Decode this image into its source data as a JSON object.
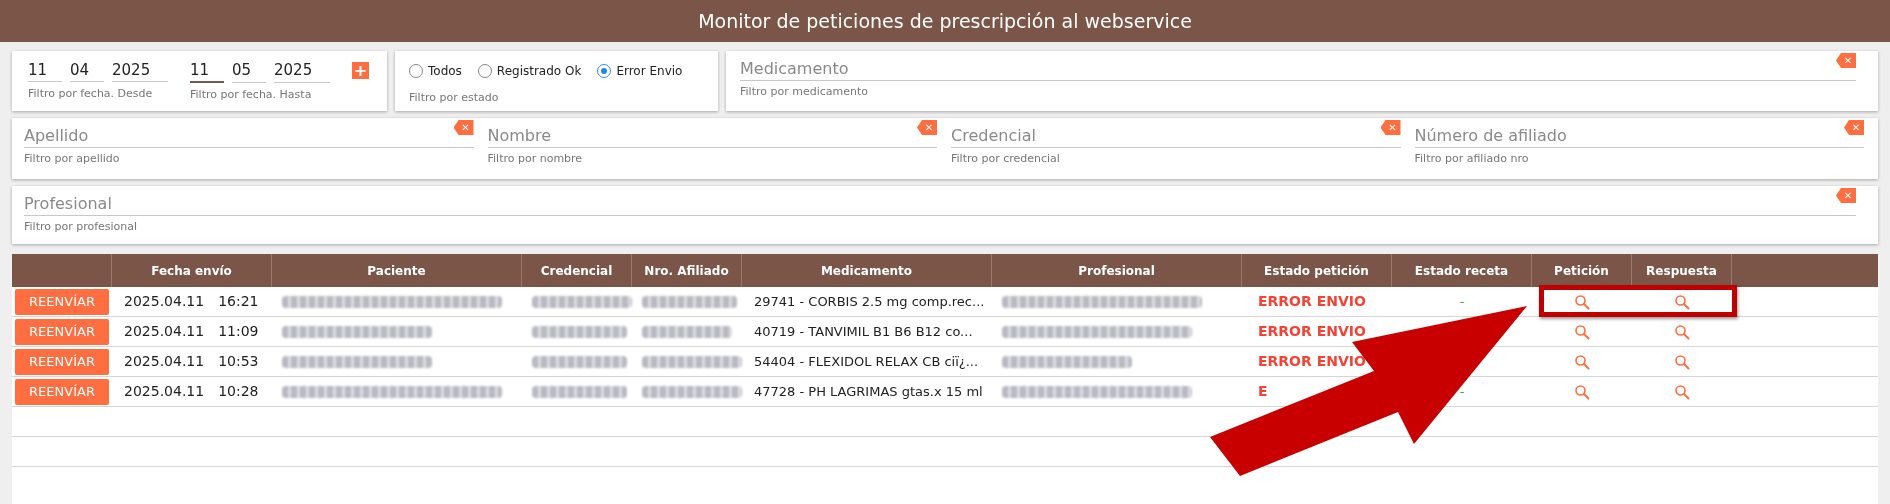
{
  "window": {
    "title": "Monitor de peticiones de prescripción al webservice"
  },
  "date_filter": {
    "from": {
      "day": "11",
      "month": "04",
      "year": "2025",
      "hint": "Filtro por fecha. Desde"
    },
    "to": {
      "day": "11",
      "month": "05",
      "year": "2025",
      "hint": "Filtro por fecha. Hasta"
    },
    "add_button": "+"
  },
  "status_filter": {
    "options": [
      {
        "label": "Todos",
        "selected": false
      },
      {
        "label": "Registrado Ok",
        "selected": false
      },
      {
        "label": "Error Envio",
        "selected": true
      }
    ],
    "hint": "Filtro por estado"
  },
  "text_filters": [
    {
      "placeholder": "Medicamento",
      "hint": "Filtro por medicamento",
      "clear": "✕"
    },
    {
      "placeholder": "Apellido",
      "hint": "Filtro por apellido",
      "clear": "✕"
    },
    {
      "placeholder": "Nombre",
      "hint": "Filtro por nombre",
      "clear": "✕"
    },
    {
      "placeholder": "Credencial",
      "hint": "Filtro por credencial",
      "clear": "✕"
    },
    {
      "placeholder": "Número de afiliado",
      "hint": "Filtro por afiliado nro",
      "clear": "✕"
    },
    {
      "placeholder": "Profesional",
      "hint": "Filtro por profesional",
      "clear": "✕"
    }
  ],
  "table": {
    "columns": [
      "",
      "Fecha envío",
      "Paciente",
      "Credencial",
      "Nro. Afiliado",
      "Medicamento",
      "Profesional",
      "Estado petición",
      "Estado receta",
      "Petición",
      "Respuesta"
    ],
    "rows": [
      {
        "action": "REENVÍAR",
        "date": "2025.04.11",
        "time": "16:21",
        "medicamento": "29741 - CORBIS 2.5 mg comp.rec...",
        "estado_peticion": "ERROR ENVIO",
        "estado_receta": "-",
        "highlighted": true
      },
      {
        "action": "REENVÍAR",
        "date": "2025.04.11",
        "time": "11:09",
        "medicamento": "40719 - TANVIMIL B1 B6 B12 co...",
        "estado_peticion": "ERROR ENVIO",
        "highlighted": false
      },
      {
        "action": "REENVÍAR",
        "date": "2025.04.11",
        "time": "10:53",
        "medicamento": "54404 - FLEXIDOL RELAX CB ciï¿...",
        "estado_peticion": "ERROR ENVIO",
        "highlighted": false
      },
      {
        "action": "REENVÍAR",
        "date": "2025.04.11",
        "time": "10:28",
        "medicamento": "47728 - PH LAGRIMAS gtas.x 15 ml",
        "estado_peticion": "E",
        "estado_receta": "-",
        "highlighted": false
      }
    ]
  }
}
